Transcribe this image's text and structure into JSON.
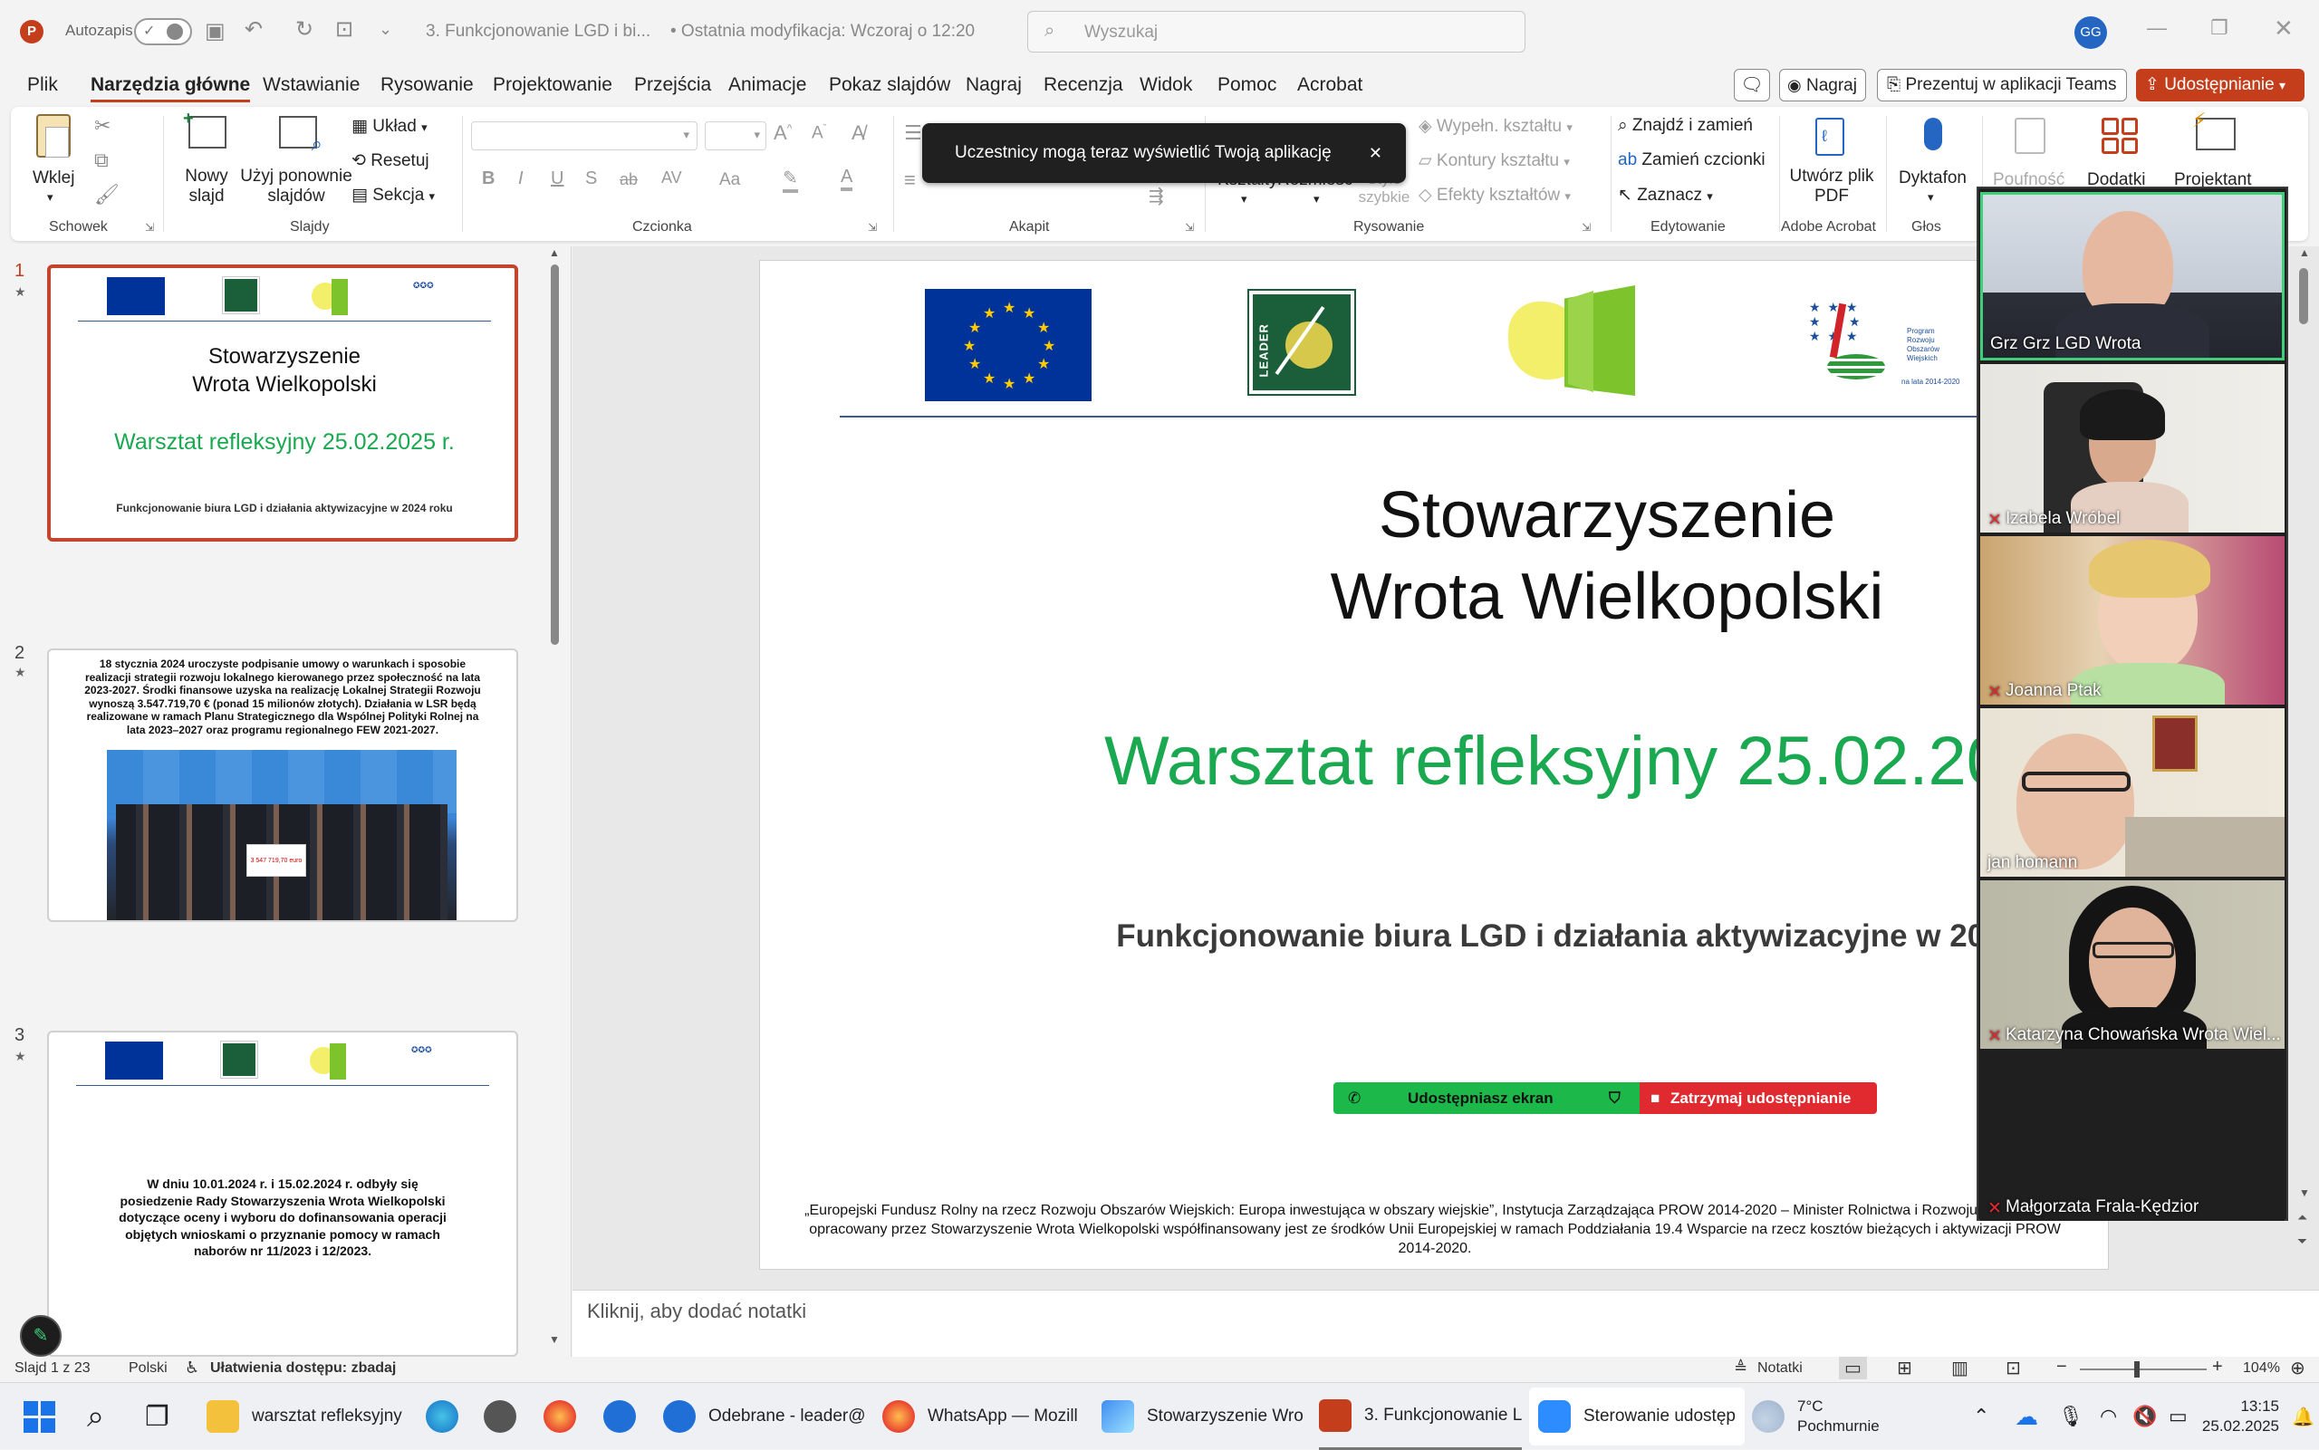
{
  "titlebar": {
    "autosave_label": "Autozapis",
    "doc_title": "3. Funkcjonowanie LGD i bi...",
    "modified": "• Ostatnia modyfikacja: Wczoraj o 12:20",
    "search_placeholder": "Wyszukaj",
    "user_initials": "GG"
  },
  "menu": {
    "tabs": [
      "Plik",
      "Narzędzia główne",
      "Wstawianie",
      "Rysowanie",
      "Projektowanie",
      "Przejścia",
      "Animacje",
      "Pokaz slajdów",
      "Nagraj",
      "Recenzja",
      "Widok",
      "Pomoc",
      "Acrobat"
    ],
    "record_button": "Nagraj",
    "teams_button": "Prezentuj w aplikacji Teams",
    "share_button": "Udostępnianie"
  },
  "ribbon": {
    "paste": "Wklej",
    "clipboard_group": "Schowek",
    "new_slide": "Nowy slajd",
    "reuse": "Użyj ponownie slajdów",
    "layout": "Układ",
    "reset": "Resetuj",
    "section": "Sekcja",
    "slides_group": "Slajdy",
    "font_group": "Czcionka",
    "paragraph_group": "Akapit",
    "shapes": "Kształty",
    "arrange": "Rozmieść",
    "styles": "Style szybkie",
    "fill": "Wypełn. kształtu",
    "outline": "Kontury kształtu",
    "effects": "Efekty kształtów",
    "drawing_group": "Rysowanie",
    "find": "Znajdź i zamień",
    "replace_fonts": "Zamień czcionki",
    "select": "Zaznacz",
    "editing_group": "Edytowanie",
    "create_pdf": "Utwórz plik PDF",
    "acrobat_group": "Adobe Acrobat",
    "dictate": "Dyktafon",
    "voice_group": "Głos",
    "sensitivity": "Poufność",
    "addins": "Dodatki",
    "designer": "Projektant",
    "toast": "Uczestnicy mogą teraz wyświetlić Twoją aplikację"
  },
  "thumbnails": [
    {
      "num": "1",
      "title": "Stowarzyszenie\nWrota Wielkopolski",
      "subtitle": "Warsztat refleksyjny 25.02.2025 r.",
      "caption": "Funkcjonowanie biura LGD i działania aktywizacyjne w 2024 roku"
    },
    {
      "num": "2",
      "text": "18 stycznia 2024 uroczyste podpisanie umowy o warunkach i sposobie realizacji strategii rozwoju lokalnego kierowanego przez społeczność na lata 2023-2027. Środki finansowe uzyska na realizację Lokalnej Strategii Rozwoju wynoszą 3.547.719,70 € (ponad 15 milionów złotych). Działania w LSR będą realizowane w ramach Planu Strategicznego dla Wspólnej Polityki Rolnej na lata 2023–2027 oraz programu regionalnego FEW 2021-2027.",
      "cheque": "3 547 719,70 euro"
    },
    {
      "num": "3",
      "text": "W dniu 10.01.2024 r. i 15.02.2024 r. odbyły się posiedzenie Rady Stowarzyszenia Wrota Wielkopolski dotyczące oceny i wyboru do dofinansowania operacji objętych wnioskami o przyznanie pomocy w ramach naborów nr 11/2023 i 12/2023."
    }
  ],
  "slide": {
    "title_line1": "Stowarzyszenie",
    "title_line2": "Wrota Wielkopolski",
    "workshop": "Warsztat refleksyjny 25.02.2025 r.",
    "subtitle": "Funkcjonowanie biura LGD i działania aktywizacyjne w 2024 roku",
    "leader_text": "LEADER",
    "prow_logo": "Program Rozwoju Obszarów Wiejskich",
    "prow_years": "na lata 2014-2020",
    "footer": "„Europejski Fundusz Rolny na rzecz Rozwoju Obszarów Wiejskich: Europa inwestująca w obszary wiejskie”, Instytucja Zarządzająca PROW 2014-2020 – Minister Rolnictwa i Rozwoju Wsi. Materiał opracowany przez Stowarzyszenie Wrota Wielkopolski współfinansowany jest ze środków Unii Europejskiej w ramach Poddziałania 19.4 Wsparcie na rzecz kosztów bieżących i aktywizacji PROW 2014-2020."
  },
  "sharebar": {
    "sharing": "Udostępniasz ekran",
    "stop": "Zatrzymaj udostępnianie"
  },
  "participants": [
    "Grz Grz LGD Wrota",
    "Izabela Wróbel",
    "Joanna Ptak",
    "jan homann",
    "Katarzyna Chowańska Wrota Wiel...",
    "Małgorzata Frala-Kędzior"
  ],
  "notes": {
    "placeholder": "Kliknij, aby dodać notatki"
  },
  "status": {
    "slide": "Slajd 1 z 23",
    "language": "Polski",
    "accessibility": "Ułatwienia dostępu: zbadaj",
    "notes": "Notatki",
    "zoom": "104%"
  },
  "taskbar": {
    "items": [
      "warsztat refleksyjny",
      "Odebrane - leader@",
      "WhatsApp — Mozill",
      "Stowarzyszenie Wro",
      "3. Funkcjonowanie L",
      "Sterowanie udostęp"
    ],
    "weather_temp": "7°C",
    "weather_desc": "Pochmurnie",
    "time": "13:15",
    "date": "25.02.2025"
  },
  "colors": {
    "accent": "#c43e1c",
    "green": "#1aa850",
    "eu_blue": "#003399",
    "teams_red": "#c4302b"
  }
}
